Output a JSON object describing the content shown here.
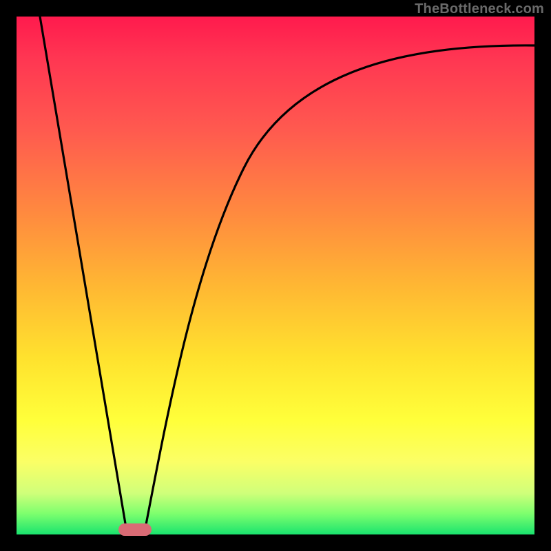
{
  "attribution": "TheBottleneck.com",
  "chart_data": {
    "type": "line",
    "title": "",
    "xlabel": "",
    "ylabel": "",
    "xlim": [
      0,
      100
    ],
    "ylim": [
      0,
      100
    ],
    "series": [
      {
        "name": "bottleneck_curve_left",
        "x": [
          5,
          21
        ],
        "values": [
          100,
          0
        ]
      },
      {
        "name": "bottleneck_curve_right",
        "x": [
          25,
          30,
          35,
          40,
          45,
          50,
          60,
          70,
          80,
          90,
          100
        ],
        "values": [
          0,
          20,
          42,
          58,
          70,
          78,
          86,
          90,
          92,
          93,
          94
        ]
      }
    ],
    "annotations": [
      {
        "type": "marker",
        "x_range": [
          20,
          26
        ],
        "y": 0,
        "color": "#d96b75"
      }
    ],
    "background_gradient": {
      "direction": "vertical",
      "stops": [
        {
          "pos": 0,
          "color": "#ff1a4d"
        },
        {
          "pos": 50,
          "color": "#ffb733"
        },
        {
          "pos": 78,
          "color": "#ffff3a"
        },
        {
          "pos": 100,
          "color": "#19e36e"
        }
      ]
    }
  }
}
